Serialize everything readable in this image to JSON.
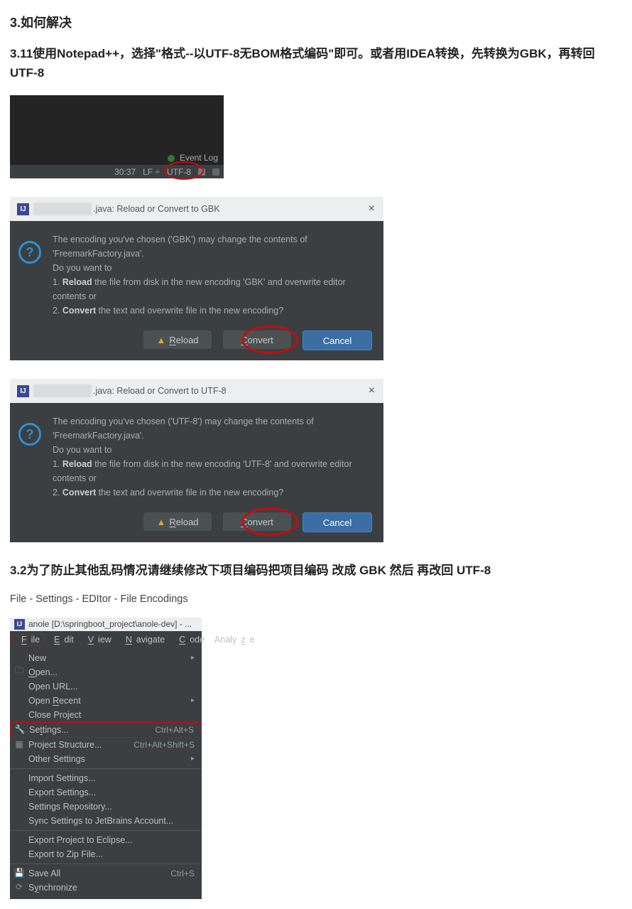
{
  "h_main": "3.如何解决",
  "h_311": "3.11使用Notepad++，选择\"格式--以UTF-8无BOM格式编码\"即可。或者用IDEA转换，先转换为GBK，再转回UTF-8",
  "shot1": {
    "event_log": "Event Log",
    "pos": "30:37",
    "sep": "LF ÷",
    "enc": "UTF-8"
  },
  "dlg_gbk": {
    "title": ".java: Reload or Convert to GBK",
    "line1a": "The encoding you've chosen ('GBK') may change the contents of 'FreemarkFactory.java'.",
    "line1b": "Do you want to",
    "line2a": "1. ",
    "line2b": "Reload",
    "line2c": " the file from disk in the new encoding 'GBK' and overwrite editor contents or",
    "line3a": "2. ",
    "line3b": "Convert",
    "line3c": " the text and overwrite file in the new encoding?",
    "btn_reload": "Reload",
    "btn_convert": "Convert",
    "btn_cancel": "Cancel"
  },
  "dlg_utf8": {
    "title": ".java: Reload or Convert to UTF-8",
    "line1a": "The encoding you've chosen ('UTF-8') may change the contents of 'FreemarkFactory.java'.",
    "line1b": "Do you want to",
    "line2a": "1. ",
    "line2b": "Reload",
    "line2c": " the file from disk in the new encoding 'UTF-8' and overwrite editor contents or",
    "line3a": "2. ",
    "line3b": "Convert",
    "line3c": " the text and overwrite file in the new encoding?",
    "btn_reload": "Reload",
    "btn_convert": "Convert",
    "btn_cancel": "Cancel"
  },
  "h_32": "3.2为了防止其他乱码情况请继续修改下项目编码把项目编码 改成 GBK 然后 再改回 UTF-8",
  "path": "File - Settings - EDItor - File Encodings",
  "shot4": {
    "winbar": "anole [D:\\springboot_project\\anole-dev] - ...",
    "menubar": {
      "file": "File",
      "edit": "Edit",
      "view": "View",
      "navigate": "Navigate",
      "code": "Code",
      "analyze": "Analyze"
    },
    "items": {
      "new": "New",
      "open": "Open...",
      "open_url": "Open URL...",
      "open_recent": "Open Recent",
      "close_project": "Close Project",
      "settings": "Settings...",
      "settings_sc": "Ctrl+Alt+S",
      "proj_struct": "Project Structure...",
      "proj_struct_sc": "Ctrl+Alt+Shift+S",
      "other_settings": "Other Settings",
      "import_settings": "Import Settings...",
      "export_settings": "Export Settings...",
      "settings_repo": "Settings Repository...",
      "sync_jb": "Sync Settings to JetBrains Account...",
      "export_eclipse": "Export Project to Eclipse...",
      "export_zip": "Export to Zip File...",
      "save_all": "Save All",
      "save_all_sc": "Ctrl+S",
      "synchronize": "Synchronize"
    }
  }
}
